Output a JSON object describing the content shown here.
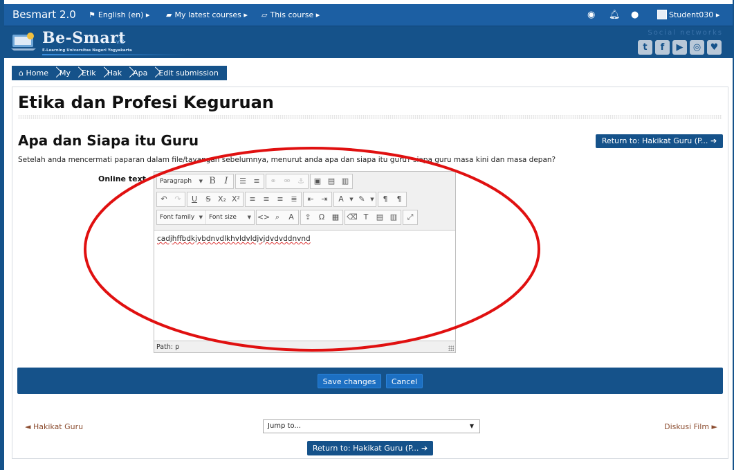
{
  "navbar": {
    "brand": "Besmart 2.0",
    "language": "English (en)",
    "my_courses": "My latest courses",
    "this_course": "This course",
    "user": "Student030"
  },
  "header": {
    "logo_text": "Be-Smart",
    "logo_version": "v.2",
    "logo_subtitle": "E-Learning Universitas Negeri Yogyakarta",
    "social_label": "Social networks",
    "social_icons": [
      "twitter-icon",
      "facebook-icon",
      "youtube-icon",
      "instagram-icon",
      "other-icon"
    ]
  },
  "breadcrumb": [
    "Home",
    "My",
    "Etik",
    "Hak",
    "Apa",
    "Edit submission"
  ],
  "course": {
    "title": "Etika dan Profesi Keguruan"
  },
  "assignment": {
    "title": "Apa dan Siapa itu Guru",
    "return_label": "Return to: Hakikat Guru (P...",
    "intro": "Setelah anda mencermati paparan dalam file/tayangan sebelumnya, menurut anda apa dan siapa itu guru? siapa guru masa kini dan masa depan?"
  },
  "form": {
    "online_text_label": "Online text",
    "editor": {
      "paragraph_select": "Paragraph",
      "font_family_select": "Font family",
      "font_size_select": "Font size",
      "content": "cadjhffbdkjvbdnvdlkhvldvldjvjdvdvddnvnd",
      "path": "Path: p"
    },
    "save_label": "Save changes",
    "cancel_label": "Cancel"
  },
  "activity_nav": {
    "prev": "◄ Hakikat Guru",
    "jump_placeholder": "Jump to...",
    "next": "Diskusi Film ►",
    "return_label": "Return to: Hakikat Guru (P..."
  },
  "colors": {
    "brand_blue": "#15528a",
    "nav_blue": "#1c5fa3",
    "annotation_red": "#e01010"
  }
}
